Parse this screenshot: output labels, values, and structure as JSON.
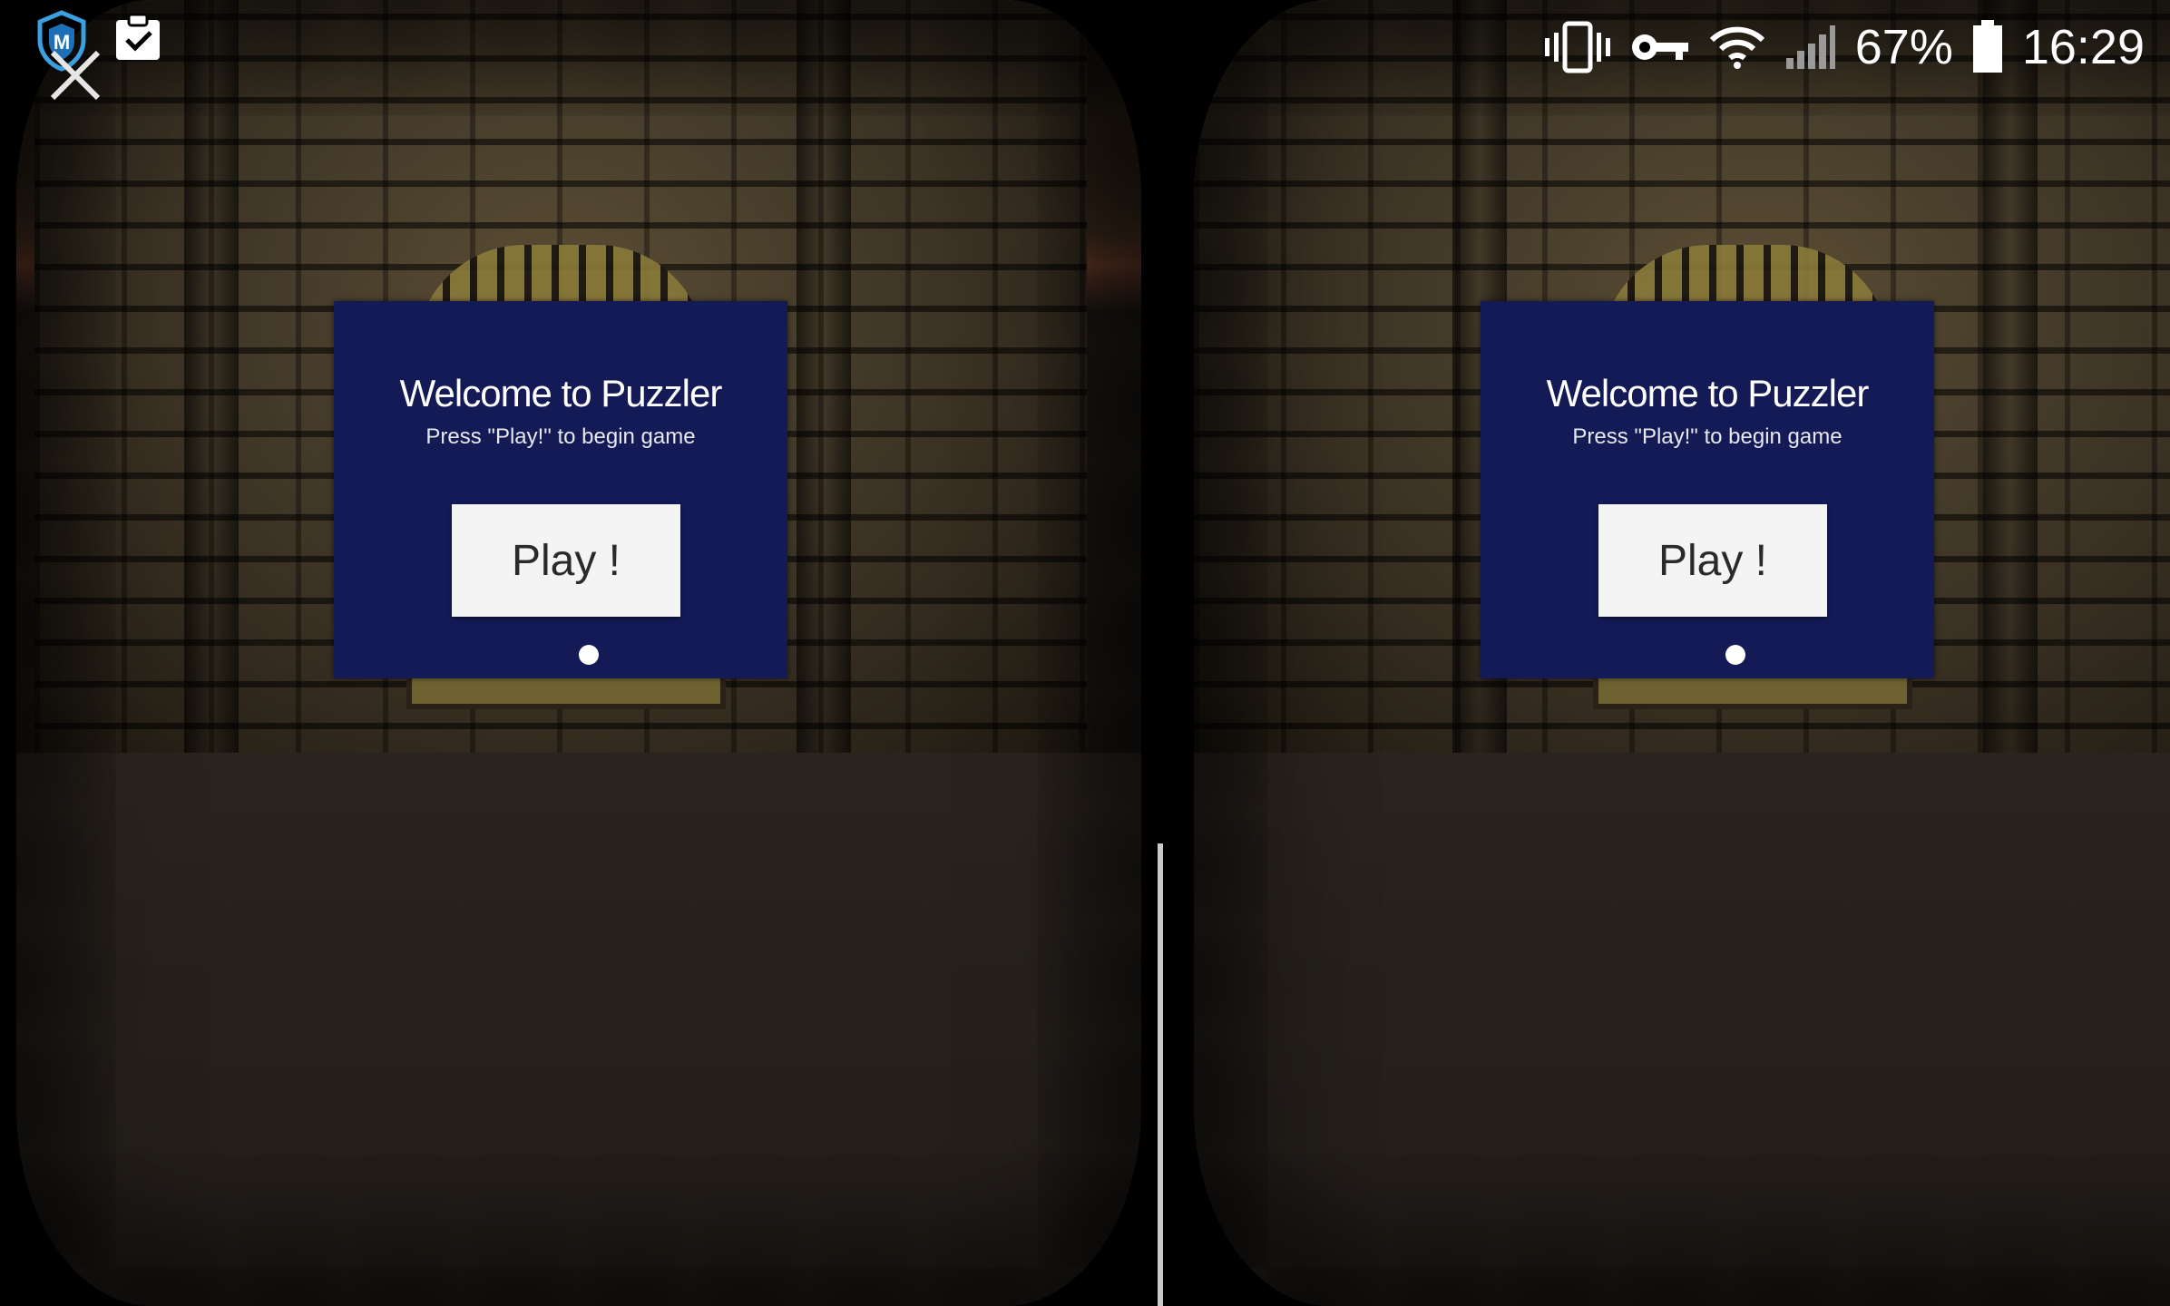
{
  "status_bar": {
    "battery_percent": "67%",
    "time": "16:29",
    "icons": {
      "left": [
        "mcafee-shield-icon",
        "clipboard-check-icon",
        "close-icon"
      ],
      "right": [
        "vibrate-icon",
        "vpn-key-icon",
        "wifi-icon",
        "cellular-signal-icon",
        "battery-icon"
      ]
    }
  },
  "left_eye": {
    "panel": {
      "title": "Welcome to Puzzler",
      "subtitle": "Press \"Play!\" to begin game",
      "play_label": "Play !"
    }
  },
  "right_eye": {
    "panel": {
      "title": "Welcome to Puzzler",
      "subtitle": "Press \"Play!\" to begin game",
      "play_label": "Play !"
    }
  },
  "colors": {
    "panel_background": "#131a55",
    "button_background": "#f4f4f4",
    "wall": "#3a3124",
    "floor": "#27211c"
  }
}
